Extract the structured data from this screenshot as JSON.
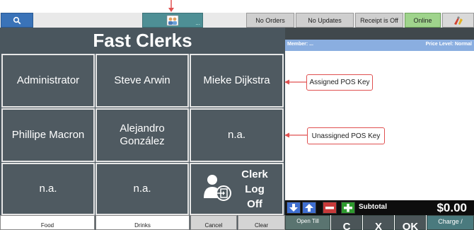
{
  "toolbar": {
    "search_icon": "magnifier-icon",
    "clerk_icon": "users-icon",
    "clerk_dots": "...",
    "no_orders": "No Orders",
    "no_updates": "No Updates",
    "receipt": "Receipt is Off",
    "online": "Online",
    "extra_icon": "tools-icon",
    "online_color": "#9fd48c"
  },
  "panel": {
    "title": "Fast Clerks",
    "clerks": [
      "Administrator",
      "Steve Arwin",
      "Mieke Dijkstra",
      "Phillipe Macron",
      "Alejandro González",
      "n.a.",
      "n.a.",
      "n.a."
    ],
    "logoff_label": "Clerk Log Off"
  },
  "bottom_buttons": {
    "food": "Food",
    "drinks": "Drinks",
    "cancel": "Cancel",
    "clear": "Clear"
  },
  "order": {
    "member": "Member: ...",
    "price_level": "Price Level: Normal",
    "subtotal_label": "Subtotal",
    "subtotal_value": "$0.00"
  },
  "functions": {
    "open_till": "Open Till",
    "c": "C",
    "x": "X",
    "ok": "OK",
    "charge": "Charge /"
  },
  "callouts": {
    "assigned": "Assigned POS Key",
    "unassigned": "Unassigned POS Key"
  },
  "colors": {
    "panel": "#4a565e",
    "member_bar": "#8aaee0",
    "annotation": "#e05050"
  }
}
